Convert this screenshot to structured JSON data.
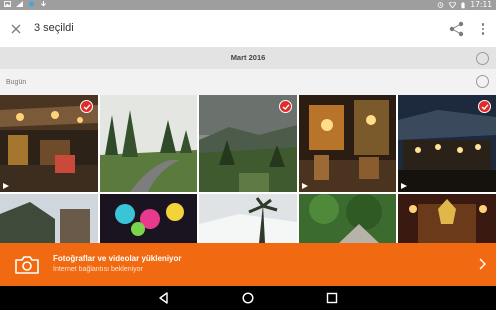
{
  "status_bar": {
    "time": "17:11",
    "icons": [
      "image-notification-icon",
      "signal-icon",
      "cloud-icon",
      "download-icon",
      "alarm-icon",
      "wifi-icon",
      "battery-icon"
    ]
  },
  "toolbar": {
    "title": "3 seçildi",
    "close_icon": "close-icon",
    "share_icon": "share-icon",
    "more_icon": "more-vert-icon"
  },
  "month_header": {
    "label": "Mart 2016"
  },
  "day_header": {
    "label": "Bugün"
  },
  "photos": [
    {
      "selected": true,
      "video": true
    },
    {
      "selected": false,
      "video": false
    },
    {
      "selected": true,
      "video": false
    },
    {
      "selected": false,
      "video": true
    },
    {
      "selected": true,
      "video": true
    },
    {
      "selected": false,
      "video": false
    },
    {
      "selected": false,
      "video": false
    },
    {
      "selected": false,
      "video": false
    },
    {
      "selected": false,
      "video": false
    },
    {
      "selected": false,
      "video": false
    }
  ],
  "upload_banner": {
    "title": "Fotoğraflar ve videolar yükleniyor",
    "subtitle": "İnternet bağlantısı bekleniyor",
    "icon": "camera-icon",
    "chevron": "chevron-right-icon"
  },
  "nav_bar": {
    "icons": [
      "back-icon",
      "home-icon",
      "recents-icon"
    ]
  },
  "colors": {
    "accent": "#f16a12",
    "selection": "#e02b2b",
    "toolbar_bg": "#ffffff",
    "status_bar_bg": "#9e9e9e"
  }
}
